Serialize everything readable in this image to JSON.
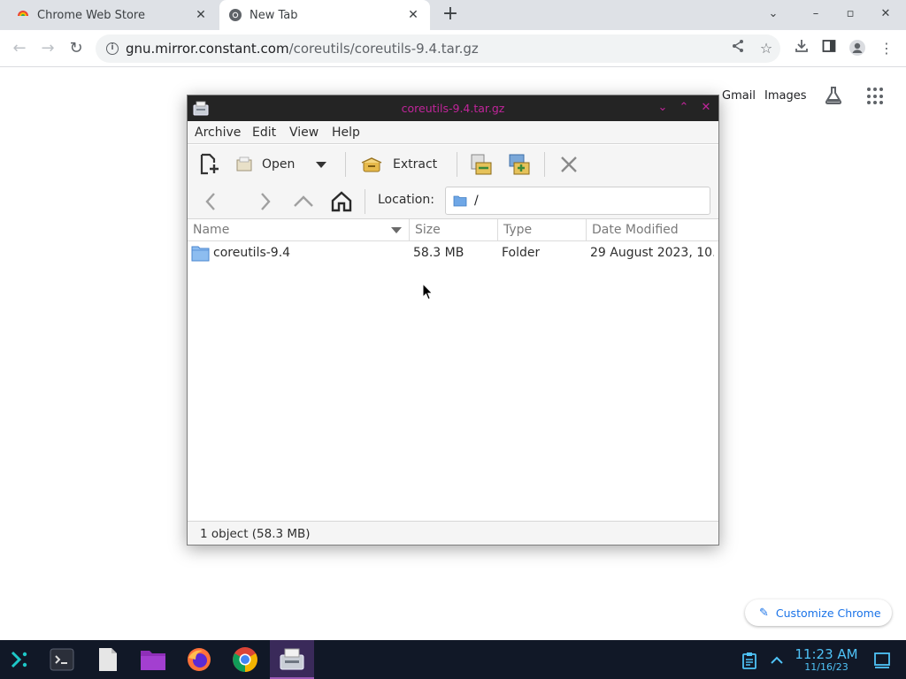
{
  "browser": {
    "tabs": [
      {
        "title": "Chrome Web Store",
        "active": false
      },
      {
        "title": "New Tab",
        "active": true
      }
    ],
    "url": {
      "host": "gnu.mirror.constant.com",
      "path": "/coreutils/coreutils-9.4.tar.gz"
    },
    "ntp": {
      "gmail": "Gmail",
      "images": "Images",
      "customize": "Customize Chrome"
    }
  },
  "archive_window": {
    "title": "coreutils-9.4.tar.gz",
    "menu": [
      "Archive",
      "Edit",
      "View",
      "Help"
    ],
    "toolbar": {
      "open_label": "Open",
      "extract_label": "Extract"
    },
    "location_label": "Location:",
    "location_value": "/",
    "columns": [
      "Name",
      "Size",
      "Type",
      "Date Modified"
    ],
    "rows": [
      {
        "name": "coreutils-9.4",
        "size": "58.3 MB",
        "type": "Folder",
        "modified": "29 August 2023, 10…"
      }
    ],
    "status": "1 object (58.3 MB)"
  },
  "taskbar": {
    "time": "11:23 AM",
    "date": "11/16/23"
  },
  "colors": {
    "title_accent": "#c0249a",
    "clock": "#4fc3f7",
    "link_blue": "#1a73e8"
  }
}
